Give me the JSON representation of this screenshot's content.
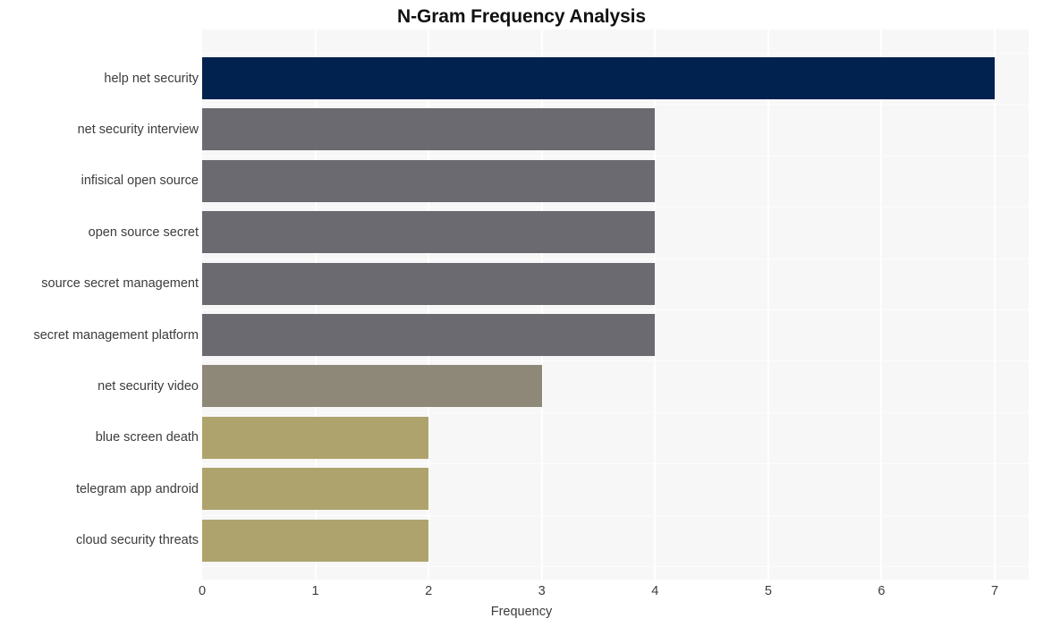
{
  "chart_data": {
    "type": "bar",
    "orientation": "horizontal",
    "title": "N-Gram Frequency Analysis",
    "xlabel": "Frequency",
    "ylabel": "",
    "xlim": [
      0,
      7.3
    ],
    "ylim": null,
    "grid": true,
    "legend": null,
    "xticks": [
      "0",
      "1",
      "2",
      "3",
      "4",
      "5",
      "6",
      "7"
    ],
    "xtick_values": [
      0,
      1,
      2,
      3,
      4,
      5,
      6,
      7
    ],
    "categories": [
      "help net security",
      "net security interview",
      "infisical open source",
      "open source secret",
      "source secret management",
      "secret management platform",
      "net security video",
      "blue screen death",
      "telegram app android",
      "cloud security threats"
    ],
    "values": [
      7,
      4,
      4,
      4,
      4,
      4,
      3,
      2,
      2,
      2
    ],
    "bar_colors": [
      "#01224f",
      "#6a6a70",
      "#6a6a70",
      "#6a6a70",
      "#6a6a70",
      "#6a6a70",
      "#8e8878",
      "#aea36c",
      "#aea36c",
      "#aea36c"
    ],
    "plot_background": "#f7f7f8",
    "grid_color": "#ffffff",
    "text_color": "#3c3c3c",
    "title_color": "#111111"
  }
}
